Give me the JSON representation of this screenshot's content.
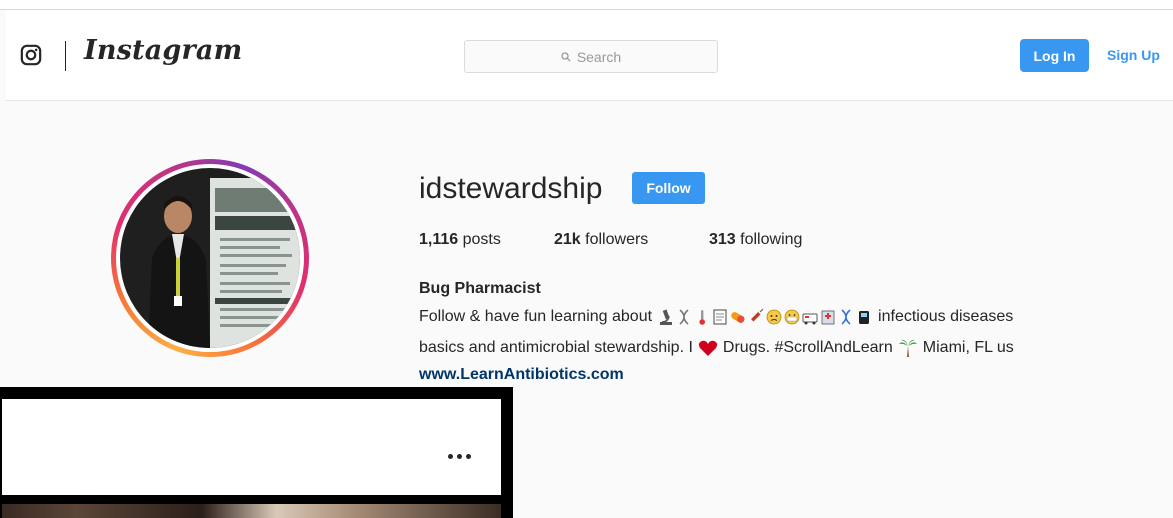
{
  "navbar": {
    "logo_icon": "instagram-camera-icon",
    "wordmark": "Instagram",
    "search_placeholder": "Search",
    "login_label": "Log In",
    "signup_label": "Sign Up"
  },
  "profile": {
    "username": "idstewardship",
    "follow_label": "Follow",
    "stats": {
      "posts_count": "1,116",
      "posts_label": "posts",
      "followers_count": "21k",
      "followers_label": "followers",
      "following_count": "313",
      "following_label": "following"
    },
    "bio": {
      "name": "Bug Pharmacist",
      "line1_prefix": "Follow & have fun learning about",
      "line1_suffix": "infectious diseases",
      "line2_prefix": "basics and antimicrobial stewardship. I",
      "line2_middle": "Drugs. #ScrollAndLearn",
      "line2_suffix": "Miami, FL us",
      "link": "www.LearnAntibiotics.com",
      "emojis": [
        "microscope",
        "dna",
        "thermometer",
        "page",
        "pill",
        "syringe",
        "sick-face",
        "mask-face",
        "ambulance",
        "hospital",
        "dna",
        "pager"
      ]
    }
  },
  "overlay": {
    "more_icon": "more-horizontal-icon"
  },
  "colors": {
    "accent": "#3897f0",
    "link": "#003569",
    "text": "#262626",
    "background": "#fafafa"
  }
}
